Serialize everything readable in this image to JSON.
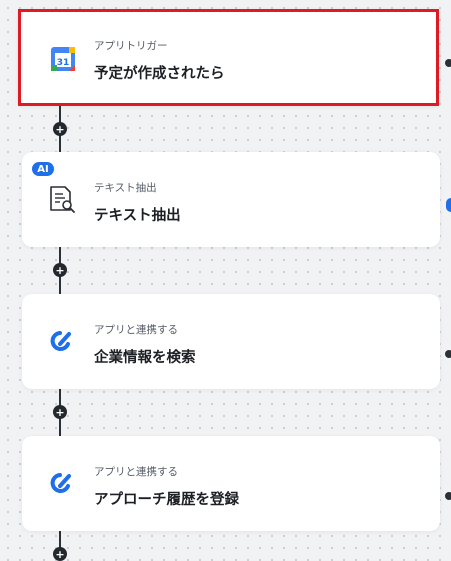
{
  "flow": {
    "steps": [
      {
        "subtitle": "アプリトリガー",
        "title": "予定が作成されたら",
        "icon": "google-calendar-icon",
        "selected": true
      },
      {
        "subtitle": "テキスト抽出",
        "title": "テキスト抽出",
        "icon": "document-search-icon",
        "badge": "AI"
      },
      {
        "subtitle": "アプリと連携する",
        "title": "企業情報を検索",
        "icon": "app-link-icon"
      },
      {
        "subtitle": "アプリと連携する",
        "title": "アプローチ履歴を登録",
        "icon": "app-link-icon"
      }
    ],
    "add_step_symbol": "+"
  },
  "colors": {
    "selection_border": "#e01a22",
    "accent_blue": "#1f6fea",
    "calendar_blue": "#4285f4",
    "calendar_green": "#34a853",
    "calendar_yellow": "#fbbc04",
    "calendar_red": "#ea4335"
  },
  "calendar_icon_text": "31"
}
